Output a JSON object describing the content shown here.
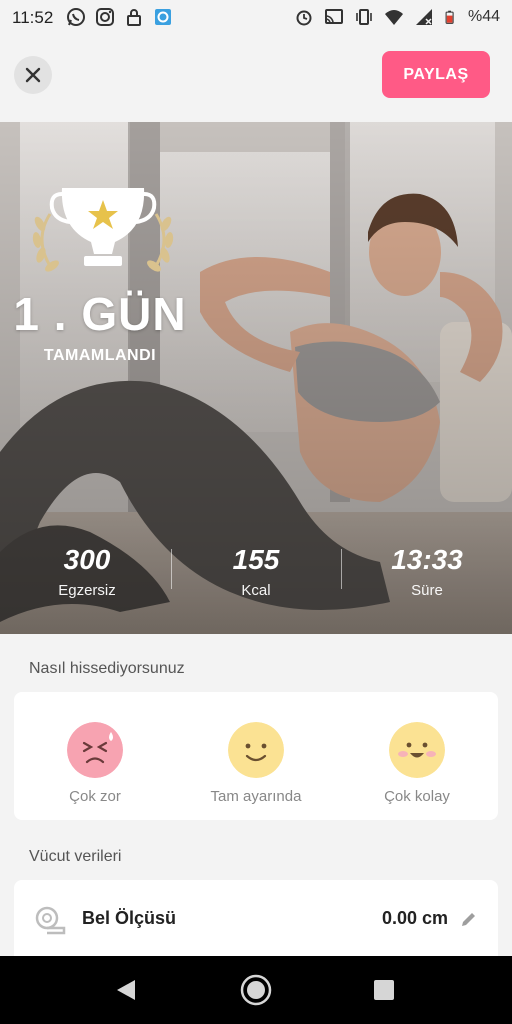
{
  "status": {
    "time": "11:52",
    "battery": "%44",
    "left_icons": [
      "whatsapp-icon",
      "instagram-icon",
      "lock-icon",
      "app-icon"
    ],
    "right_icons": [
      "alarm-icon",
      "cast-icon",
      "vibrate-icon",
      "wifi-icon",
      "signal-icon",
      "battery-icon"
    ]
  },
  "header": {
    "share_label": "PAYLAŞ"
  },
  "hero": {
    "day_title": "1 . GÜN",
    "day_sub": "TAMAMLANDI",
    "stats": [
      {
        "value": "300",
        "label": "Egzersiz"
      },
      {
        "value": "155",
        "label": "Kcal"
      },
      {
        "value": "13:33",
        "label": "Süre"
      }
    ]
  },
  "feelings": {
    "title": "Nasıl hissediyorsunuz",
    "options": [
      {
        "label": "Çok zor",
        "color": "#f7a3b1"
      },
      {
        "label": "Tam ayarında",
        "color": "#fbe293"
      },
      {
        "label": "Çok kolay",
        "color": "#fbe293"
      }
    ]
  },
  "body": {
    "title": "Vücut verileri",
    "rows": [
      {
        "label": "Bel Ölçüsü",
        "value": "0.00 cm"
      }
    ]
  },
  "colors": {
    "accent": "#ff5a86",
    "background": "#f3f3f3"
  }
}
